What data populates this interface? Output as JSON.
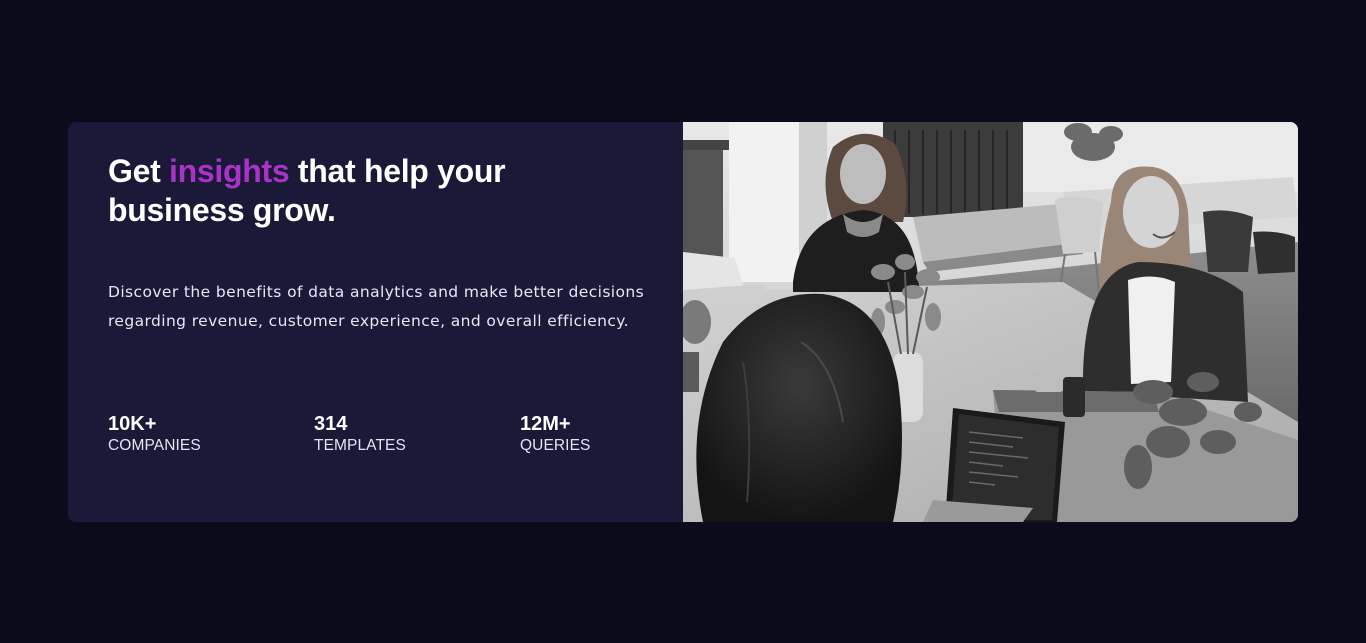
{
  "hero": {
    "headline_before": "Get",
    "headline_accent": "insights",
    "headline_after": "that help your business grow.",
    "description": "Discover the benefits of data analytics and make better decisions regarding revenue, customer experience, and overall efficiency.",
    "accent_color": "#aa32c8",
    "stats": [
      {
        "value": "10K+",
        "label": "COMPANIES"
      },
      {
        "value": "314",
        "label": "TEMPLATES"
      },
      {
        "value": "12M+",
        "label": "QUERIES"
      }
    ]
  },
  "image": {
    "subject": "grayscale-office-photo"
  }
}
